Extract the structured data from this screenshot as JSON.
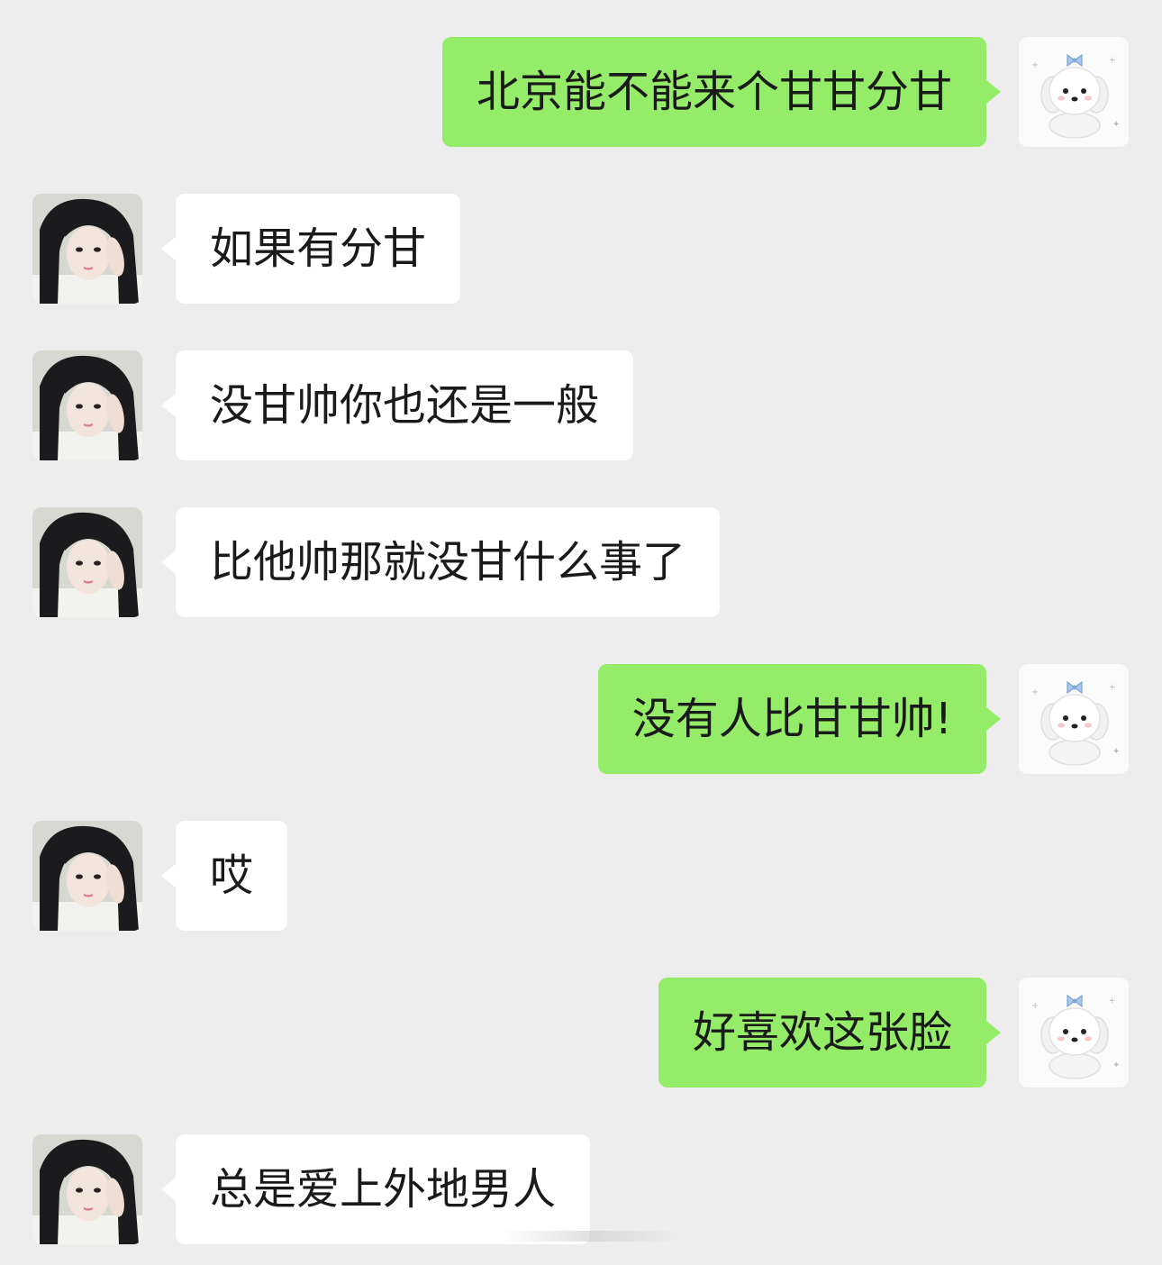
{
  "conversation": {
    "messages": [
      {
        "side": "right",
        "sender": "self",
        "avatar": "white-puppy-avatar",
        "text": "北京能不能来个甘甘分甘"
      },
      {
        "side": "left",
        "sender": "contact",
        "avatar": "girl-photo-avatar",
        "text": "如果有分甘"
      },
      {
        "side": "left",
        "sender": "contact",
        "avatar": "girl-photo-avatar",
        "text": "没甘帅你也还是一般"
      },
      {
        "side": "left",
        "sender": "contact",
        "avatar": "girl-photo-avatar",
        "text": "比他帅那就没甘什么事了"
      },
      {
        "side": "right",
        "sender": "self",
        "avatar": "white-puppy-avatar",
        "text": "没有人比甘甘帅!"
      },
      {
        "side": "left",
        "sender": "contact",
        "avatar": "girl-photo-avatar",
        "text": "哎"
      },
      {
        "side": "right",
        "sender": "self",
        "avatar": "white-puppy-avatar",
        "text": "好喜欢这张脸"
      },
      {
        "side": "left",
        "sender": "contact",
        "avatar": "girl-photo-avatar",
        "text": "总是爱上外地男人"
      }
    ]
  },
  "colors": {
    "background": "#ededed",
    "self_bubble": "#95ec69",
    "contact_bubble": "#ffffff",
    "text": "#1a1a1a"
  }
}
